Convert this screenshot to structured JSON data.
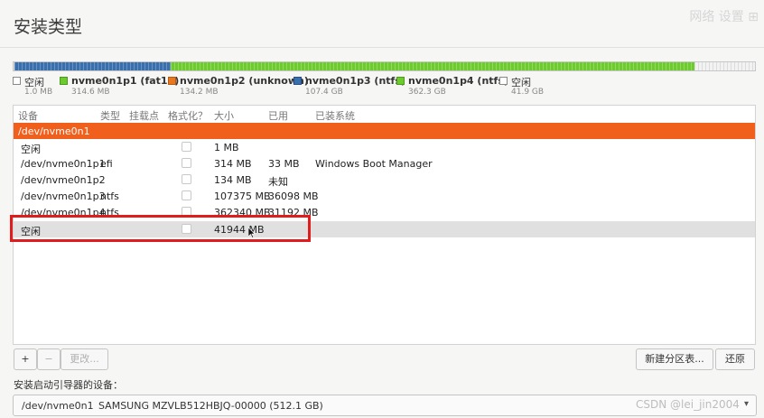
{
  "window": {
    "title": "安装类型",
    "top_right_mark": "网络 设置 ⊞"
  },
  "partition_bar": {
    "segments": [
      {
        "type": "free",
        "fraction": 2.4e-06
      },
      {
        "type": "blue",
        "fraction": 0.146
      },
      {
        "type": "green",
        "fraction": 0.7635
      },
      {
        "type": "free",
        "fraction": 0.0905
      }
    ]
  },
  "legend": [
    {
      "name": "空闲",
      "size": "1.0 MB",
      "color": "#ffffff"
    },
    {
      "name": "nvme0n1p1 (fat16)",
      "size": "314.6 MB",
      "color": "#6dcb2e"
    },
    {
      "name": "nvme0n1p2 (unknown)",
      "size": "134.2 MB",
      "color": "#e8771d"
    },
    {
      "name": "nvme0n1p3 (ntfs)",
      "size": "107.4 GB",
      "color": "#3a6fae"
    },
    {
      "name": "nvme0n1p4 (ntfs)",
      "size": "362.3 GB",
      "color": "#6dcb2e"
    },
    {
      "name": "空闲",
      "size": "41.9 GB",
      "color": "#ffffff"
    }
  ],
  "table": {
    "headers": {
      "device": "设备",
      "type": "类型",
      "mount": "挂载点",
      "format": "格式化？",
      "size": "大小",
      "used": "已用",
      "system": "已装系统"
    },
    "disk": "/dev/nvme0n1",
    "rows": [
      {
        "device": "空闲",
        "type": "",
        "size": "1 MB",
        "used": "",
        "system": ""
      },
      {
        "device": "/dev/nvme0n1p1",
        "type": "efi",
        "size": "314 MB",
        "used": "33 MB",
        "system": "Windows Boot Manager"
      },
      {
        "device": "/dev/nvme0n1p2",
        "type": "",
        "size": "134 MB",
        "used": "未知",
        "system": ""
      },
      {
        "device": "/dev/nvme0n1p3",
        "type": "ntfs",
        "size": "107375 MB",
        "used": "36098 MB",
        "system": ""
      },
      {
        "device": "/dev/nvme0n1p4",
        "type": "ntfs",
        "size": "362340 MB",
        "used": "31192 MB",
        "system": ""
      },
      {
        "device": "空闲",
        "type": "",
        "size": "41944 MB",
        "used": "",
        "system": ""
      }
    ]
  },
  "buttons": {
    "add": "+",
    "remove": "−",
    "change": "更改...",
    "new_table": "新建分区表...",
    "revert": "还原"
  },
  "boot": {
    "label": "安装启动引导器的设备：",
    "device": "/dev/nvme0n1",
    "model": "SAMSUNG MZVLB512HBJQ-00000 (512.1 GB)",
    "arrow": "▾"
  },
  "watermark": "CSDN @lei_jin2004"
}
